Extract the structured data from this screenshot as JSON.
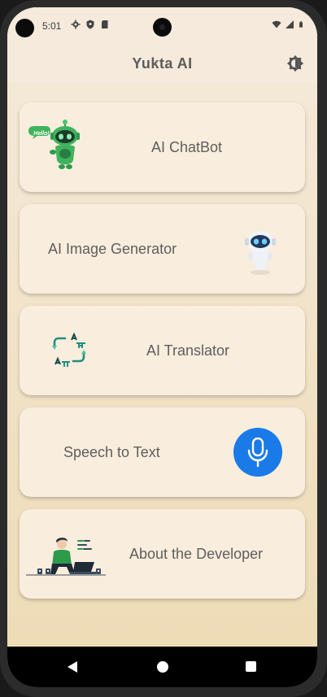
{
  "status_bar": {
    "time": "5:01",
    "left_icons": [
      "settings-icon",
      "shield-icon",
      "sd-card-icon"
    ],
    "right_icons": [
      "wifi-icon",
      "signal-icon",
      "battery-icon"
    ]
  },
  "app_bar": {
    "title": "Yukta AI",
    "action_icon": "brightness-icon"
  },
  "cards": [
    {
      "label": "AI ChatBot",
      "icon": "chatbot-robot-icon",
      "badge": "Hello!"
    },
    {
      "label": "AI Image Generator",
      "icon": "robot-icon"
    },
    {
      "label": "AI Translator",
      "icon": "translate-icon"
    },
    {
      "label": "Speech to Text",
      "icon": "microphone-icon"
    },
    {
      "label": "About the Developer",
      "icon": "developer-illustration-icon"
    }
  ],
  "nav_bar": [
    "back-icon",
    "home-icon",
    "recents-icon"
  ],
  "colors": {
    "background_top": "#f5eadb",
    "background_bottom": "#eddbb4",
    "card": "#f9eddd",
    "mic_button": "#1a7be8",
    "chatbot_green": "#2e9b4a",
    "translator_teal": "#1f8f7e"
  }
}
